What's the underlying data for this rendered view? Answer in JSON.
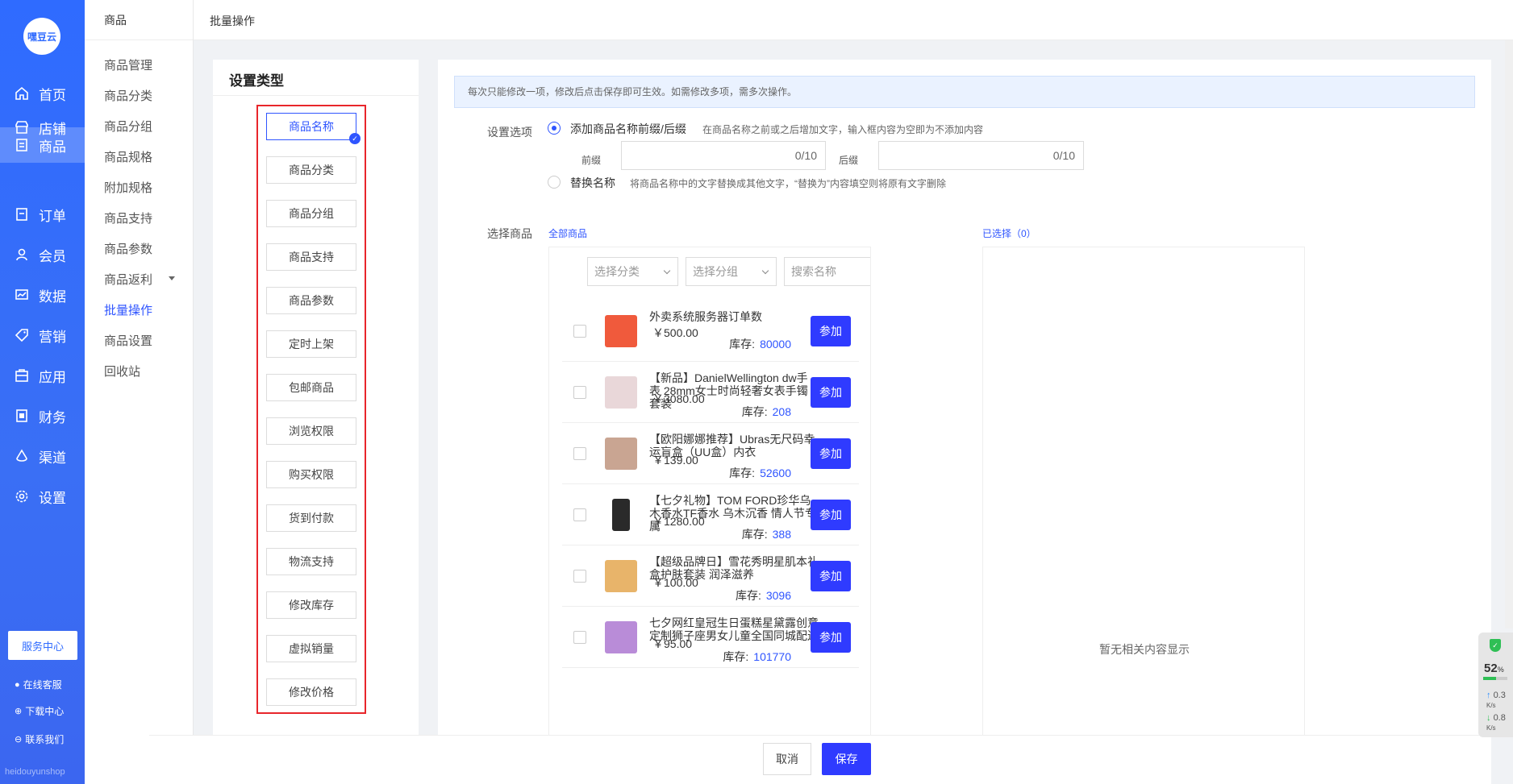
{
  "nav": {
    "logo": "嘿豆云",
    "items": [
      {
        "label": "首页",
        "icon": "home-icon"
      },
      {
        "label": "店铺",
        "icon": "store-icon"
      },
      {
        "label": "商品",
        "icon": "goods-icon"
      },
      {
        "label": "订单",
        "icon": "order-icon"
      },
      {
        "label": "会员",
        "icon": "member-icon"
      },
      {
        "label": "数据",
        "icon": "data-icon"
      },
      {
        "label": "营销",
        "icon": "tag-icon"
      },
      {
        "label": "应用",
        "icon": "app-icon"
      },
      {
        "label": "财务",
        "icon": "finance-icon"
      },
      {
        "label": "渠道",
        "icon": "channel-icon"
      },
      {
        "label": "设置",
        "icon": "settings-icon"
      }
    ],
    "service_center": "服务中心",
    "links": [
      "在线客服",
      "下载中心",
      "联系我们"
    ],
    "footer": "heidouyunshop"
  },
  "submenu": {
    "title": "商品",
    "items": [
      "商品管理",
      "商品分类",
      "商品分组",
      "商品规格",
      "附加规格",
      "商品支持",
      "商品参数",
      "商品返利",
      "批量操作",
      "商品设置",
      "回收站"
    ]
  },
  "topbar": {
    "breadcrumb": "批量操作"
  },
  "types": {
    "title": "设置类型",
    "items": [
      "商品名称",
      "商品分类",
      "商品分组",
      "商品支持",
      "商品参数",
      "定时上架",
      "包邮商品",
      "浏览权限",
      "购买权限",
      "货到付款",
      "物流支持",
      "修改库存",
      "虚拟销量",
      "修改价格"
    ]
  },
  "main": {
    "notice": "每次只能修改一项，修改后点击保存即可生效。如需修改多项，需多次操作。",
    "option_label": "设置选项",
    "option1": {
      "text": "添加商品名称前缀/后缀",
      "hint": "在商品名称之前或之后增加文字，输入框内容为空即为不添加内容"
    },
    "prefix_label": "前缀",
    "prefix_count": "0/10",
    "suffix_label": "后缀",
    "suffix_count": "0/10",
    "option2": {
      "text": "替换名称",
      "hint": "将商品名称中的文字替换成其他文字，“替换为”内容填空则将原有文字删除"
    },
    "select_label": "选择商品",
    "all_goods": "全部商品",
    "selected": "已选择（0）",
    "filter_category": "选择分类",
    "filter_group": "选择分组",
    "search_placeholder": "搜索名称",
    "stock_label": "库存:",
    "join_label": "参加",
    "empty": "暂无相关内容显示",
    "products": [
      {
        "name": "外卖系统服务器订单数",
        "price": "￥500.00",
        "stock": "80000",
        "thumb_color": "#f05a3c"
      },
      {
        "name": "【新品】DanielWellington dw手表 28mm女士时尚轻奢女表手镯套装",
        "price": "￥3080.00",
        "stock": "208",
        "thumb_color": "#e9d7d9"
      },
      {
        "name": "【欧阳娜娜推荐】Ubras无尺码幸运盲盒（UU盒）内衣",
        "price": "￥139.00",
        "stock": "52600",
        "thumb_color": "#c9a592"
      },
      {
        "name": "【七夕礼物】TOM FORD珍华乌木香水TF香水 乌木沉香 情人节专属",
        "price": "￥1280.00",
        "stock": "388",
        "thumb_color": "#2a2a2a"
      },
      {
        "name": "【超级品牌日】雪花秀明星肌本礼盒护肤套装 润泽滋养",
        "price": "￥100.00",
        "stock": "3096",
        "thumb_color": "#e8b46a"
      },
      {
        "name": "七夕网红皇冠生日蛋糕星黛露创意定制狮子座男女儿童全国同城配送",
        "price": "￥95.00",
        "stock": "101770",
        "thumb_color": "#b98cd8"
      }
    ]
  },
  "buttons": {
    "cancel": "取消",
    "save": "保存"
  },
  "widget": {
    "percent": "52",
    "percent_unit": "%",
    "up": "0.3",
    "down": "0.8",
    "unit": "K/s"
  },
  "colors": {
    "primary": "#2f55ff",
    "nav_bg": "#2f6bff",
    "highlight_border": "#e8262b"
  }
}
